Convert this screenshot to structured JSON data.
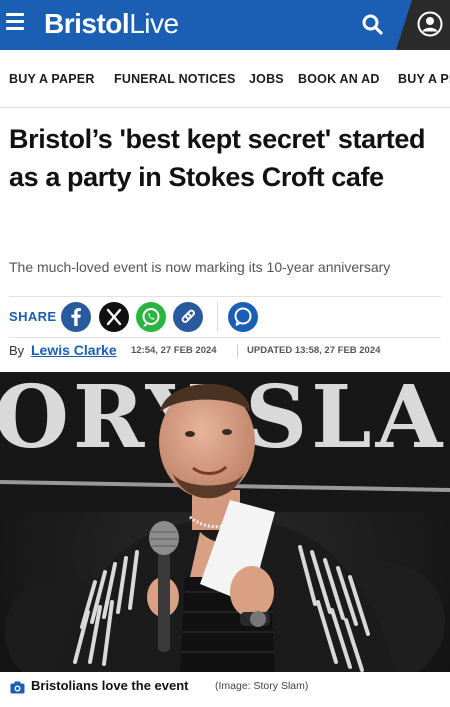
{
  "header": {
    "brand_part1": "Bristol",
    "brand_part2": "Live",
    "brand_color": "#1a5fb4",
    "icons": [
      "hamburger-menu-icon",
      "search-icon",
      "user-account-icon"
    ]
  },
  "nav": {
    "items": [
      "BUY A PAPER",
      "FUNERAL NOTICES",
      "JOBS",
      "BOOK AN AD",
      "BUY A PI"
    ]
  },
  "article": {
    "headline": "Bristol’s 'best kept secret' started as a party in Stokes Croft cafe",
    "standfirst": "The much-loved event is now marking its 10-year anniversary",
    "share_label": "SHARE",
    "share_icons": [
      "facebook-icon",
      "x-twitter-icon",
      "whatsapp-icon",
      "copy-link-icon",
      "comments-icon"
    ],
    "byline_prefix": "By",
    "author": "Lewis Clarke",
    "published": "12:54, 27 FEB 2024",
    "updated": "UPDATED 13:58, 27 FEB 2024"
  },
  "hero": {
    "banner_text": "ORY SLA"
  },
  "caption": {
    "text": "Bristolians love the event",
    "credit": "(Image: Story Slam)"
  }
}
